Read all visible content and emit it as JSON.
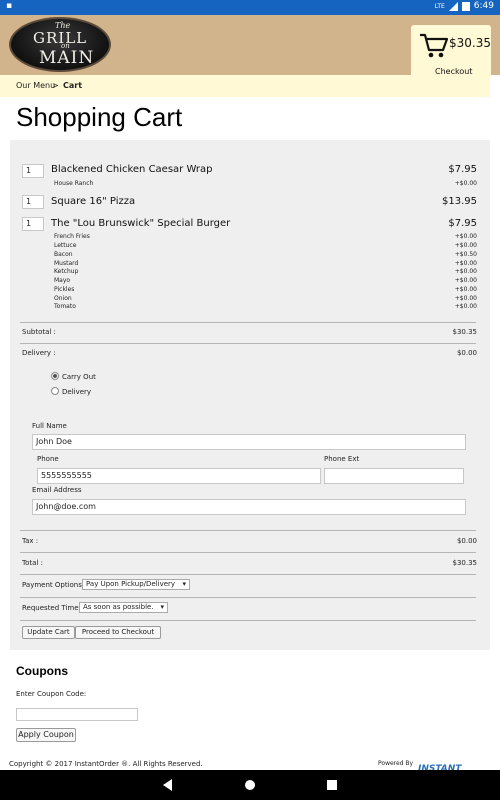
{
  "status_bar": {
    "time": "6:49",
    "network": "LTE"
  },
  "header": {
    "logo": {
      "line1": "The",
      "line2": "GRILL",
      "line3": "on",
      "line4": "MAIN"
    },
    "cart_total": "$30.35",
    "checkout_link": "Checkout"
  },
  "breadcrumb": {
    "parent": "Our Menu",
    "separator": ">",
    "current": "Cart"
  },
  "page_title": "Shopping Cart",
  "items": [
    {
      "qty": "1",
      "name": "Blackened Chicken Caesar Wrap",
      "price": "$7.95",
      "modifiers": [
        {
          "name": "House Ranch",
          "price": "+$0.00"
        }
      ]
    },
    {
      "qty": "1",
      "name": "Square 16\" Pizza",
      "price": "$13.95",
      "modifiers": []
    },
    {
      "qty": "1",
      "name": "The \"Lou Brunswick\" Special Burger",
      "price": "$7.95",
      "modifiers": [
        {
          "name": "French Fries",
          "price": "+$0.00"
        },
        {
          "name": "Lettuce",
          "price": "+$0.00"
        },
        {
          "name": "Bacon",
          "price": "+$0.50"
        },
        {
          "name": "Mustard",
          "price": "+$0.00"
        },
        {
          "name": "Ketchup",
          "price": "+$0.00"
        },
        {
          "name": "Mayo",
          "price": "+$0.00"
        },
        {
          "name": "Pickles",
          "price": "+$0.00"
        },
        {
          "name": "Onion",
          "price": "+$0.00"
        },
        {
          "name": "Tomato",
          "price": "+$0.00"
        }
      ]
    }
  ],
  "summary": {
    "subtotal_label": "Subtotal :",
    "subtotal": "$30.35",
    "delivery_label": "Delivery :",
    "delivery": "$0.00",
    "tax_label": "Tax :",
    "tax": "$0.00",
    "total_label": "Total :",
    "total": "$30.35"
  },
  "order_type": {
    "options": [
      "Carry Out",
      "Delivery"
    ],
    "selected": "Carry Out"
  },
  "contact": {
    "full_name_label": "Full Name",
    "full_name": "John Doe",
    "phone_label": "Phone",
    "phone": "5555555555",
    "phone_ext_label": "Phone Ext",
    "phone_ext": "",
    "email_label": "Email Address",
    "email": "John@doe.com"
  },
  "payment": {
    "label": "Payment Options :",
    "selected": "Pay Upon Pickup/Delivery"
  },
  "requested_time": {
    "label": "Requested Time :",
    "selected": "As soon as possible."
  },
  "buttons": {
    "update_cart": "Update Cart",
    "proceed": "Proceed to Checkout"
  },
  "coupons": {
    "title": "Coupons",
    "label": "Enter Coupon Code:",
    "value": "",
    "apply": "Apply Coupon"
  },
  "footer": {
    "copyright": "Copyright © 2017 InstantOrder ®. All Rights Reserved.",
    "powered_by": "Powered By",
    "brand": "INSTANT"
  },
  "icons": [
    "cart-icon",
    "back-icon",
    "home-icon",
    "recents-icon",
    "dropdown-arrow-icon",
    "signal-icon",
    "battery-icon"
  ]
}
